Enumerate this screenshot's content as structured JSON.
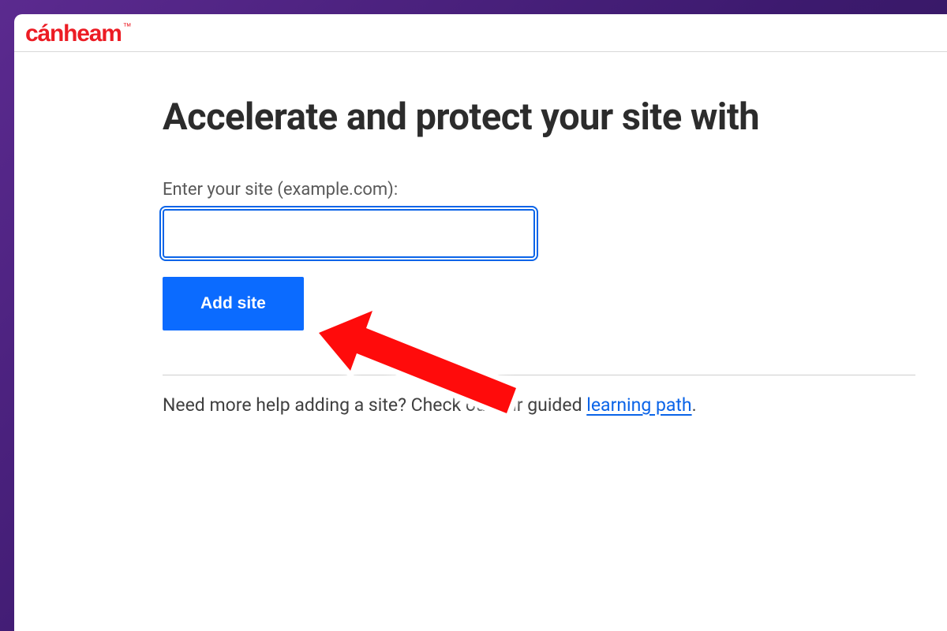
{
  "logo": {
    "text": "cánheam",
    "trademark": "™"
  },
  "main": {
    "heading": "Accelerate and protect your site with",
    "field_label": "Enter your site (example.com):",
    "input_value": "",
    "add_button_label": "Add site",
    "help_prefix": "Need more help adding a site? Check out our guided ",
    "help_link_label": "learning path",
    "help_suffix": "."
  },
  "annotation": {
    "type": "arrow",
    "color": "#ff0b0b",
    "points_to": "add-site-button"
  }
}
